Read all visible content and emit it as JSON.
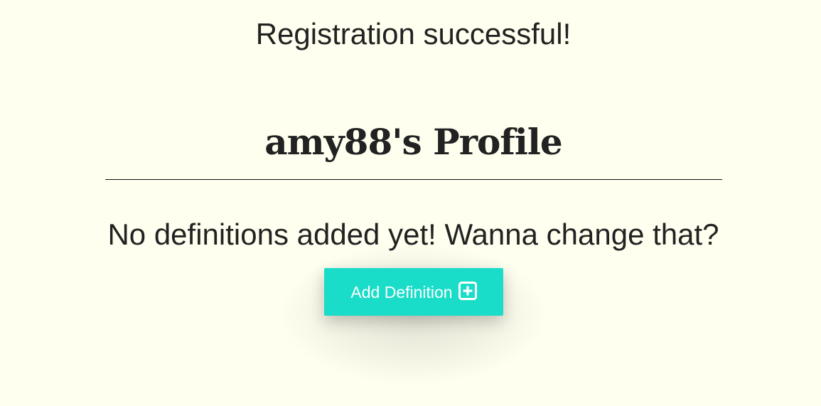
{
  "flash": {
    "message": "Registration successful!"
  },
  "profile": {
    "title": "amy88's Profile"
  },
  "definitions": {
    "empty_message": "No definitions added yet! Wanna change that?",
    "add_button_label": "Add Definition",
    "add_button_icon": "plus-square-icon"
  },
  "colors": {
    "background": "#fffff0",
    "accent": "#19ddc8",
    "text": "#222222"
  }
}
